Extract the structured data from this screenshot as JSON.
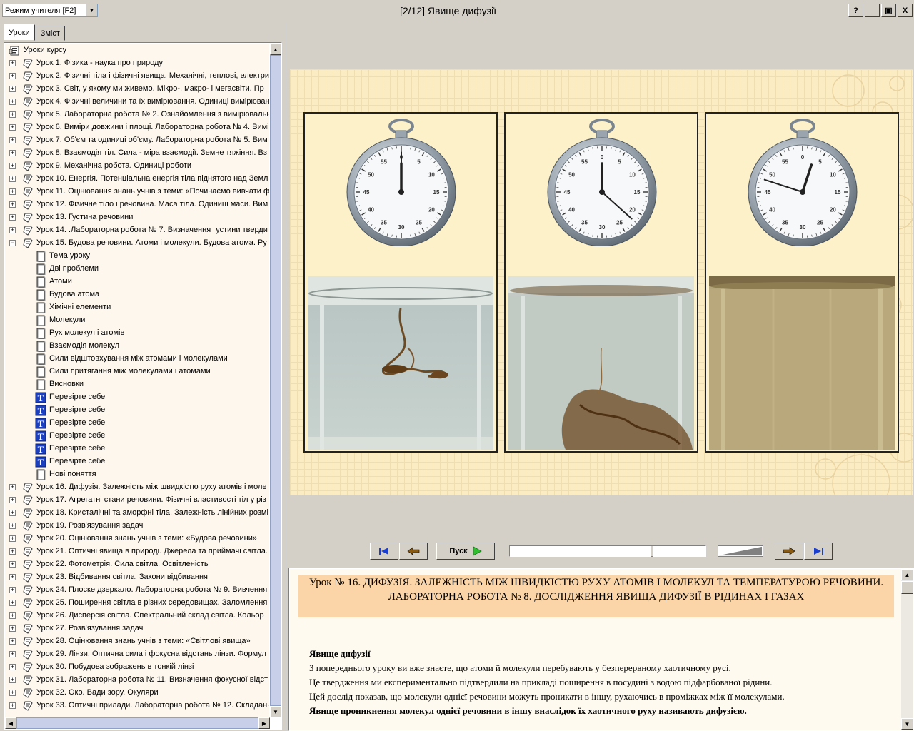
{
  "toolbar": {
    "mode": "Режим учителя [F2]",
    "title": "[2/12] Явище дифузії"
  },
  "window_buttons": [
    "?",
    "_",
    "▣",
    "X"
  ],
  "tabs": [
    "Уроки",
    "Зміст"
  ],
  "tree": {
    "root": "Уроки курсу",
    "lessons_before": [
      "Урок 1. Фізика - наука про природу",
      "Урок 2. Фізичні тіла і фізичні явища. Механічні, теплові, електри",
      "Урок 3. Світ, у якому ми живемо. Мікро-, макро- і мегасвіти. Пр",
      "Урок 4. Фізичні величини та їх вимірювання. Одиниці вимірюван",
      "Урок 5. Лабораторна робота № 2. Ознайомлення з вимірювальн",
      "Урок 6. Виміри довжини і площі. Лабораторна робота № 4. Вимі",
      "Урок 7. Об'єм та одиниці об'єму. Лабораторна робота № 5. Вим",
      "Урок 8. Взаємодія тіл. Сила - міра взаємодії. Земне тяжіння. Вз",
      "Урок 9. Механічна робота. Одиниці роботи",
      "Урок 10. Енергія. Потенціальна енергія тіла піднятого над Земл",
      "Урок 11. Оцінювання знань учнів з теми: «Починаємо вивчати ф",
      "Урок 12. Фізичне тіло і речовина. Маса тіла. Одиниці маси. Вим",
      "Урок 13. Густина речовини",
      "Урок 14. .Лабораторна робота № 7. Визначення густини тверди"
    ],
    "open_lesson": "Урок 15. Будова речовини. Атоми і молекули. Будова атома. Ру",
    "children": [
      {
        "label": "Тема уроку",
        "icon": "page"
      },
      {
        "label": "Дві проблеми",
        "icon": "page"
      },
      {
        "label": "Атоми",
        "icon": "page"
      },
      {
        "label": "Будова атома",
        "icon": "page"
      },
      {
        "label": "Хімічні елементи",
        "icon": "page"
      },
      {
        "label": "Молекули",
        "icon": "page"
      },
      {
        "label": "Рух молекул і атомів",
        "icon": "page"
      },
      {
        "label": "Взаємодія молекул",
        "icon": "page"
      },
      {
        "label": "Сили відштовхування між атомами і молекулами",
        "icon": "page"
      },
      {
        "label": "Сили притягання між молекулами і атомами",
        "icon": "page"
      },
      {
        "label": "Висновки",
        "icon": "page"
      },
      {
        "label": "Перевірте себе",
        "icon": "test"
      },
      {
        "label": "Перевірте себе",
        "icon": "test"
      },
      {
        "label": "Перевірте себе",
        "icon": "test"
      },
      {
        "label": "Перевірте себе",
        "icon": "test"
      },
      {
        "label": "Перевірте себе",
        "icon": "test"
      },
      {
        "label": "Перевірте себе",
        "icon": "test"
      },
      {
        "label": "Нові поняття",
        "icon": "page"
      }
    ],
    "lessons_after": [
      "Урок 16. Дифузія. Залежність між швидкістю руху атомів і моле",
      "Урок 17. Агрегатні стани речовини. Фізичні властивості тіл у різ",
      "Урок 18. Кристалічні та аморфні тіла. Залежність лінійних розмі",
      "Урок 19. Розв'язування задач",
      "Урок 20. Оцінювання знань учнів з теми: «Будова речовини»",
      "Урок 21. Оптичні явища в природі. Джерела та приймачі світла.",
      "Урок 22. Фотометрія. Сила світла. Освітленість",
      "Урок 23. Відбивання світла. Закони відбивання",
      "Урок 24. Плоске дзеркало. Лабораторна робота № 9. Вивчення",
      "Урок 25. Поширення світла в різних середовищах. Заломлення",
      "Урок 26. Дисперсія світла. Спектральний склад світла. Кольор",
      "Урок 27. Розв'язування задач",
      "Урок 28. Оцінювання знань учнів з теми: «Світлові явища»",
      "Урок 29. Лінзи. Оптична сила і фокусна відстань лінзи. Формул",
      "Урок 30. Побудова зображень в тонкій лінзі",
      "Урок 31. Лабораторна робота № 11. Визначення фокусної відст",
      "Урок 32. Око. Вади зору. Окуляри",
      "Урок 33. Оптичні прилади. Лабораторна робота № 12. Складанн"
    ]
  },
  "stopwatches": [
    {
      "minute_hand_seconds": 0,
      "second_hand_seconds": 0
    },
    {
      "minute_hand_seconds": 0,
      "second_hand_seconds": 22
    },
    {
      "minute_hand_seconds": 3,
      "second_hand_seconds": 48
    }
  ],
  "watch_numbers": [
    "0",
    "5",
    "10",
    "15",
    "20",
    "25",
    "30",
    "35",
    "40",
    "45",
    "50",
    "55"
  ],
  "controls": {
    "play_label": "Пуск",
    "progress": 0.73
  },
  "lesson": {
    "heading": "Урок № 16. ДИФУЗІЯ. ЗАЛЕЖНІСТЬ МІЖ ШВИДКІСТЮ РУХУ АТОМІВ І МОЛЕКУЛ ТА ТЕМПЕРАТУРОЮ РЕЧОВИНИ. ЛАБОРАТОРНА РОБОТА № 8. ДОСЛІДЖЕННЯ ЯВИЩА ДИФУЗІЇ В РІДИНАХ І ГАЗАХ",
    "subheading": "Явище дифузії",
    "p1": "З попереднього уроку ви вже знаєте, що атоми й молекули перебувають у безперервному хаотичному русі.",
    "p2": "Це твердження ми експериментально підтвердили на прикладі поширення в посудині з водою підфарбованої рідини.",
    "p3": "Цей дослід показав, що молекули однієї речовини можуть проникати в іншу, рухаючись в проміжках між її молекулами.",
    "p4": "Явище проникнення молекул однієї речовини в іншу внаслідок їх хаотичного руху називають дифузією."
  }
}
